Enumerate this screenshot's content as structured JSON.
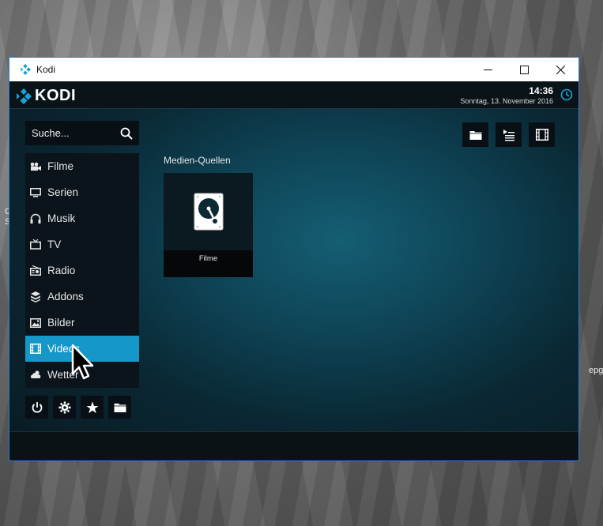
{
  "desktop": {
    "left_text": "C\nS",
    "right_text": "epg"
  },
  "window": {
    "title": "Kodi",
    "minimize": "—",
    "maximize": "☐",
    "close": "✕"
  },
  "kodi": {
    "logo_text": "KODI",
    "time": "14:36",
    "date": "Sonntag, 13. November 2016",
    "search_placeholder": "Suche...",
    "menu": [
      {
        "label": "Filme",
        "icon": "movie-camera-icon"
      },
      {
        "label": "Serien",
        "icon": "tv-monitor-icon"
      },
      {
        "label": "Musik",
        "icon": "headphones-icon"
      },
      {
        "label": "TV",
        "icon": "tv-icon"
      },
      {
        "label": "Radio",
        "icon": "radio-icon"
      },
      {
        "label": "Addons",
        "icon": "addons-box-icon"
      },
      {
        "label": "Bilder",
        "icon": "picture-icon"
      },
      {
        "label": "Videos",
        "icon": "film-strip-icon"
      },
      {
        "label": "Wetter",
        "icon": "weather-icon"
      }
    ],
    "active_menu": "Videos",
    "section_title": "Medien-Quellen",
    "tiles": [
      {
        "label": "Filme",
        "icon": "hard-drive-icon"
      }
    ]
  },
  "colors": {
    "accent": "#1597c9",
    "window_border": "#2a7bd4"
  }
}
